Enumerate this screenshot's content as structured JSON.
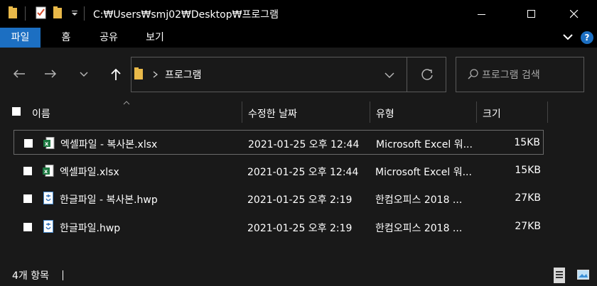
{
  "window": {
    "title": "C:₩Users₩smj02₩Desktop₩프로그램",
    "min_icon": "minimize-icon",
    "max_icon": "maximize-icon",
    "close_icon": "close-icon"
  },
  "ribbon": {
    "tabs": [
      "파일",
      "홈",
      "공유",
      "보기"
    ]
  },
  "nav": {
    "breadcrumb_folder": "프로그램",
    "search_placeholder": "프로그램 검색"
  },
  "columns": {
    "name": "이름",
    "modified": "수정한 날짜",
    "type": "유형",
    "size": "크기"
  },
  "files": [
    {
      "name": "엑셀파일 - 복사본.xlsx",
      "modified": "2021-01-25 오후 12:44",
      "type": "Microsoft Excel 워...",
      "size": "15KB",
      "icon": "excel-file-icon"
    },
    {
      "name": "엑셀파일.xlsx",
      "modified": "2021-01-25 오후 12:44",
      "type": "Microsoft Excel 워...",
      "size": "15KB",
      "icon": "excel-file-icon"
    },
    {
      "name": "한글파일 - 복사본.hwp",
      "modified": "2021-01-25 오후 2:19",
      "type": "한컴오피스 2018 ...",
      "size": "27KB",
      "icon": "hwp-file-icon"
    },
    {
      "name": "한글파일.hwp",
      "modified": "2021-01-25 오후 2:19",
      "type": "한컴오피스 2018 ...",
      "size": "27KB",
      "icon": "hwp-file-icon"
    }
  ],
  "status": {
    "item_count": "4개 항목"
  },
  "colors": {
    "accent": "#1c6fc2",
    "background": "#191919"
  }
}
